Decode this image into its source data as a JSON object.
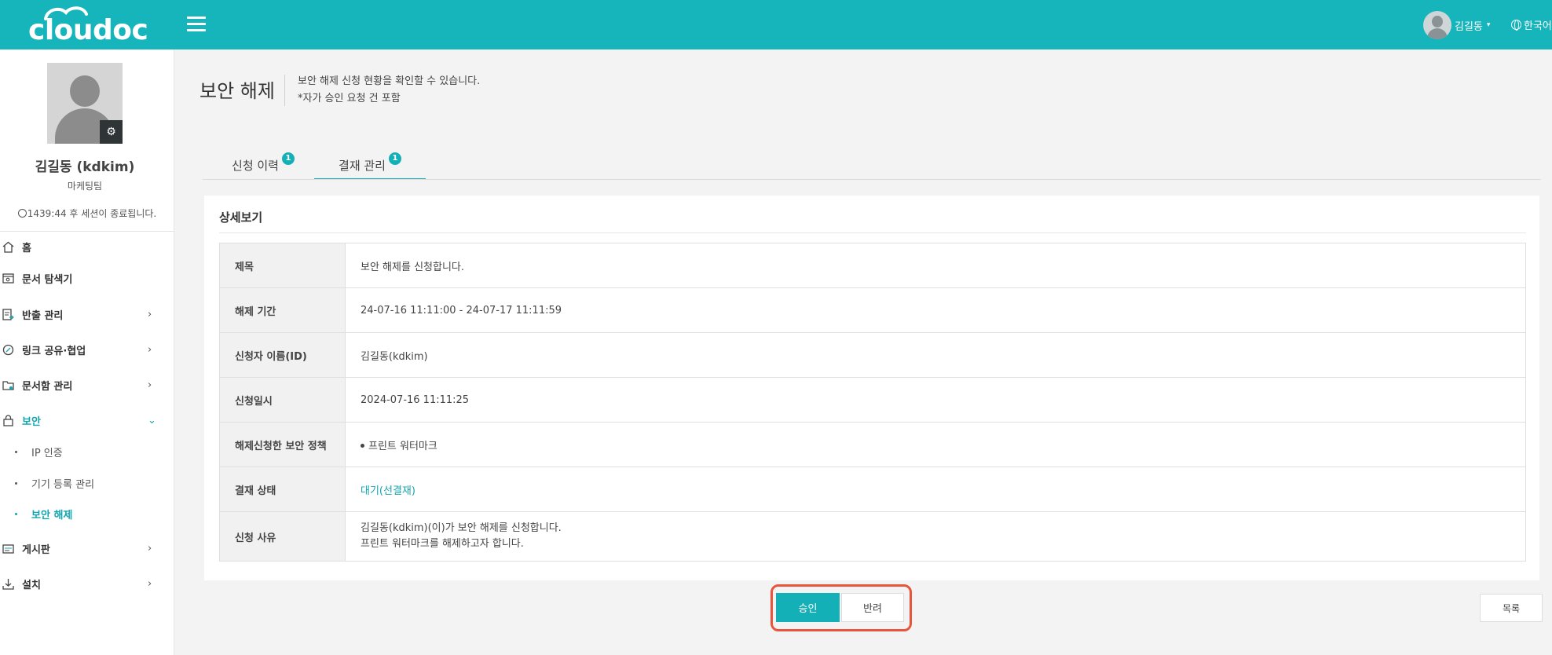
{
  "header": {
    "logo_text": "cloudoc",
    "user_name": "김길동",
    "language": "한국어"
  },
  "sidebar": {
    "profile_name": "김길동 (kdkim)",
    "profile_team": "마케팅팀",
    "session_text": "1439:44 후 세션이 종료됩니다.",
    "items": [
      {
        "label": "홈",
        "icon": "home-icon"
      },
      {
        "label": "문서 탐색기",
        "icon": "document-explorer-icon"
      },
      {
        "label": "반출 관리",
        "icon": "export-icon"
      },
      {
        "label": "링크 공유·협업",
        "icon": "link-share-icon"
      },
      {
        "label": "문서함 관리",
        "icon": "folder-settings-icon"
      },
      {
        "label": "보안",
        "icon": "lock-icon"
      },
      {
        "label": "게시판",
        "icon": "board-icon"
      },
      {
        "label": "설치",
        "icon": "download-icon"
      }
    ],
    "sub_items": [
      {
        "label": "IP 인증"
      },
      {
        "label": "기기 등록 관리"
      },
      {
        "label": "보안 해제"
      }
    ]
  },
  "page": {
    "title": "보안 해제",
    "desc_line1": "보안 해제 신청 현황을 확인할 수 있습니다.",
    "desc_line2": "*자가 승인 요청 건 포함"
  },
  "tabs": [
    {
      "label": "신청 이력",
      "badge": "1"
    },
    {
      "label": "결재 관리",
      "badge": "1"
    }
  ],
  "detail": {
    "heading": "상세보기",
    "rows": [
      {
        "label": "제목",
        "value": "보안 해제를 신청합니다."
      },
      {
        "label": "해제 기간",
        "value": "24-07-16 11:11:00 - 24-07-17 11:11:59"
      },
      {
        "label": "신청자 이름(ID)",
        "value": "김길동(kdkim)"
      },
      {
        "label": "신청일시",
        "value": "2024-07-16 11:11:25"
      },
      {
        "label": "해제신청한 보안 정책",
        "value": "프린트 워터마크"
      },
      {
        "label": "결재 상태",
        "value": "대기(선결재)"
      },
      {
        "label": "신청 사유",
        "value_line1": "김길동(kdkim)(이)가 보안 해제를 신청합니다.",
        "value_line2": "프린트 워터마크를 해제하고자 합니다."
      }
    ]
  },
  "actions": {
    "approve": "승인",
    "reject": "반려",
    "list": "목록"
  },
  "colors": {
    "accent": "#16b5bc",
    "highlight_box": "#e8553a"
  }
}
